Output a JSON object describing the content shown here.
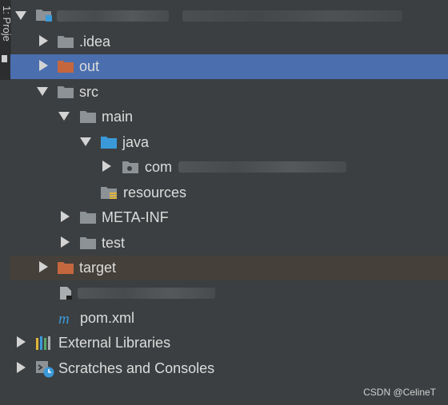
{
  "sidebar": {
    "label": "1: Proje"
  },
  "tree": {
    "idea": ".idea",
    "out": "out",
    "src": "src",
    "main": "main",
    "java": "java",
    "com": "com",
    "resources": "resources",
    "meta_inf": "META-INF",
    "test": "test",
    "target": "target",
    "pom": "pom.xml",
    "external_libraries": "External Libraries",
    "scratches": "Scratches and Consoles"
  },
  "watermark": "CSDN @CelineT",
  "colors": {
    "selected": "#4b6eaf",
    "excluded": "#45403a",
    "folder": "#8d9296",
    "source_folder": "#3a9ad9",
    "target_folder": "#c4673f"
  }
}
